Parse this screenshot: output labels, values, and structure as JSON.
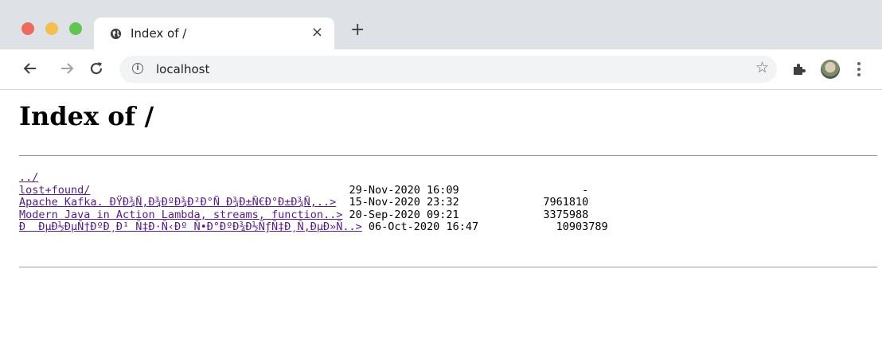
{
  "tab": {
    "title": "Index of /",
    "close_label": "×",
    "new_tab_label": "+"
  },
  "address_bar": {
    "url": "localhost"
  },
  "page": {
    "heading": "Index of /",
    "parent_link": "../",
    "entries": [
      {
        "name": "lost+found/",
        "date": "29-Nov-2020 16:09",
        "size": "-"
      },
      {
        "name": "Apache Kafka. ÐŸÐ¾Ñ‚Ð¾ÐºÐ¾Ð²Ð°Ñ Ð¾Ð±Ñ€Ð°Ð±Ð¾Ñ‚..>",
        "date": "15-Nov-2020 23:32",
        "size": "7961810"
      },
      {
        "name": "Modern Java in Action Lambda, streams, function..>",
        "date": "20-Sep-2020 09:21",
        "size": "3375988"
      },
      {
        "name": "Ð  ÐµÐ½ÐµÑ†ÐºÐ¸Ð¹ Ñ‡Ð·Ñ‹Ðº Ñ•Ð°ÐºÐ¾Ð½ÑƒÑ‡Ð¸Ñ‚ÐµÐ»Ñ..>",
        "date": "06-Oct-2020 16:47",
        "size": "10903789"
      }
    ]
  },
  "icons": {
    "tab_favicon": "globe-icon",
    "back": "arrow-left-icon",
    "forward": "arrow-right-icon",
    "reload": "reload-icon",
    "site_info": "info-icon",
    "bookmark": "star-icon",
    "extensions": "puzzle-icon",
    "profile": "avatar",
    "menu": "more-vertical-icon"
  },
  "colors": {
    "tab_strip": "#dee1e6",
    "visited_link": "#551a8b",
    "omnibox": "#f1f3f4"
  }
}
